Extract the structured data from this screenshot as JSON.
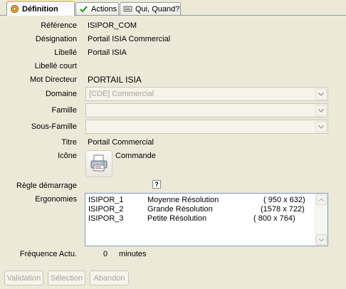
{
  "tabs": [
    {
      "label": "Définition",
      "icon": "gear-icon"
    },
    {
      "label": "Actions",
      "icon": "checkmark-icon"
    },
    {
      "label": "Qui, Quand?",
      "icon": "keyboard-icon"
    }
  ],
  "form": {
    "reference": {
      "label": "Référence",
      "value": "ISIPOR_COM"
    },
    "designation": {
      "label": "Désignation",
      "value": "Portail ISIA Commercial"
    },
    "libelle": {
      "label": "Libellé",
      "value": "Portail ISIA"
    },
    "libelle_court": {
      "label": "Libellé court",
      "value": ""
    },
    "mot_directeur": {
      "label": "Mot Directeur",
      "value": "PORTAIL ISIA"
    },
    "domaine": {
      "label": "Domaine",
      "value": "[CDE] Commercial"
    },
    "famille": {
      "label": "Famille",
      "value": ""
    },
    "sous_famille": {
      "label": "Sous-Famille",
      "value": ""
    },
    "titre": {
      "label": "Titre",
      "value": "Portail Commercial"
    },
    "icone": {
      "label": "Icône",
      "value": "Commande",
      "icon": "printer-icon"
    },
    "regle_demarrage": {
      "label": "Règle démarrage",
      "help": "?"
    },
    "ergonomies": {
      "label": "Ergonomies",
      "rows": [
        {
          "code": "ISIPOR_1",
          "name": "Moyenne Résolution",
          "size": "( 950 x  632)"
        },
        {
          "code": "ISIPOR_2",
          "name": "Grande Résolution",
          "size": "(1578 x  722)"
        },
        {
          "code": "ISIPOR_3",
          "name": "Petite Résolution",
          "size": "( 800 x  764)"
        }
      ]
    },
    "frequence": {
      "label": "Fréquence Actu.",
      "value": "0",
      "unit": "minutes"
    }
  },
  "buttons": {
    "validation": "Validation",
    "selection": "Sélection",
    "abandon": "Abandon"
  },
  "colors": {
    "accent_tab": "#ffc83c",
    "disabled_text": "#a6a49b",
    "list_border": "#7f9db9"
  }
}
